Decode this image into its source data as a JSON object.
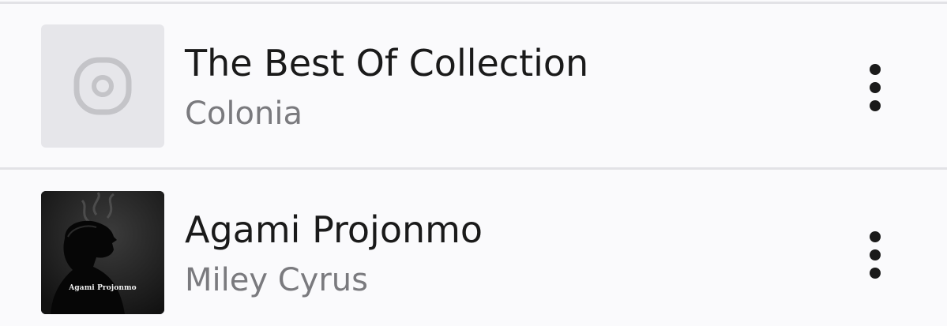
{
  "tracks": [
    {
      "title": "The Best Of Collection",
      "artist": "Colonia",
      "artwork_icon": "album-placeholder-icon",
      "menu_icon": "more-vertical-icon"
    },
    {
      "title": "Agami Projonmo",
      "artist": "Miley Cyrus",
      "artwork_caption": "Agami Projonmo",
      "menu_icon": "more-vertical-icon"
    }
  ],
  "colors": {
    "background": "#fafafc",
    "divider": "#e2e2e6",
    "title": "#1a1a1a",
    "subtitle": "#7a7a7e",
    "placeholder_bg": "#e6e6ea",
    "placeholder_icon": "#c4c4c8"
  }
}
